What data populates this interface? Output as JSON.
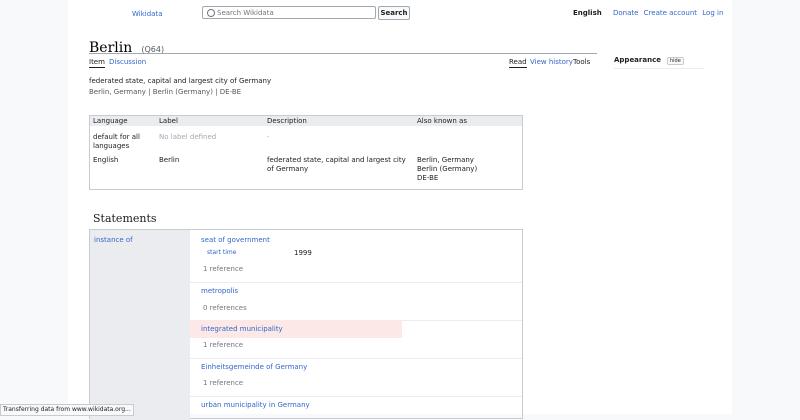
{
  "header": {
    "logo_text": "Wikidata",
    "search_placeholder": "Search Wikidata",
    "search_button": "Search",
    "language": "English",
    "links": [
      "Donate",
      "Create account",
      "Log in"
    ]
  },
  "item": {
    "title": "Berlin",
    "qid": "(Q64)",
    "description": "federated state, capital and largest city of Germany",
    "aliases": "Berlin, Germany | Berlin (Germany) | DE-BE"
  },
  "tabs": {
    "left": [
      "Item",
      "Discussion"
    ],
    "right": [
      "Read",
      "View history",
      "Tools"
    ]
  },
  "appearance": {
    "label": "Appearance",
    "hide": "hide"
  },
  "terms_table": {
    "headers": [
      "Language",
      "Label",
      "Description",
      "Also known as"
    ],
    "rows": [
      {
        "language": "default for all languages",
        "label": "No label defined",
        "description": "-",
        "aliases": ""
      },
      {
        "language": "English",
        "label": "Berlin",
        "description": "federated state, capital and largest city of Germany",
        "aliases": "Berlin, Germany\nBerlin (Germany)\nDE-BE"
      }
    ]
  },
  "statements": {
    "heading": "Statements",
    "property": "instance of",
    "values": [
      {
        "label": "seat of government",
        "qualifier": "start time",
        "qualifier_value": "1999",
        "refs": "1 reference"
      },
      {
        "label": "metropolis",
        "refs": "0 references"
      },
      {
        "label": "integrated municipality",
        "refs": "1 reference"
      },
      {
        "label": "Einheitsgemeinde of Germany",
        "refs": "1 reference"
      },
      {
        "label": "urban municipality in Germany",
        "refs": ""
      }
    ]
  },
  "status_bar": "Transferring data from www.wikidata.org..."
}
